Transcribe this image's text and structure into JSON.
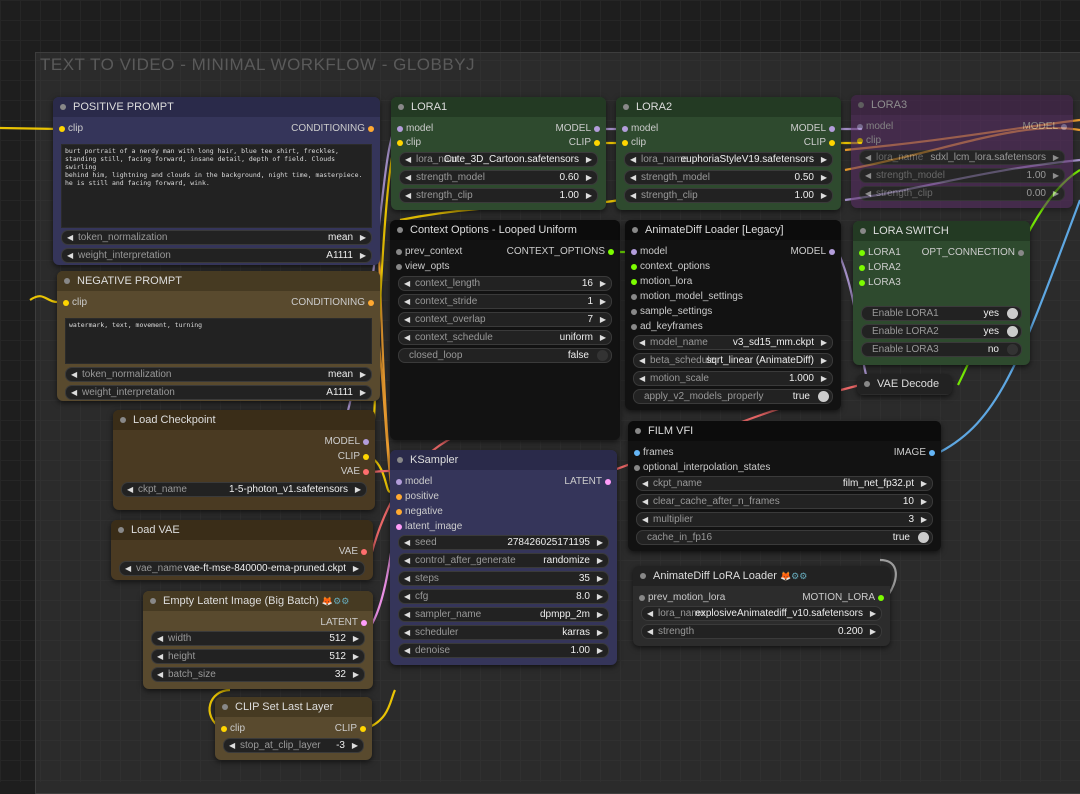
{
  "group_title": "TEXT TO VIDEO - MINIMAL WORKFLOW - GLOBBYJ",
  "positive_prompt": {
    "title": "POSITIVE PROMPT",
    "in_clip": "clip",
    "out": "CONDITIONING",
    "text": "burt portrait of a nerdy man with long hair, blue tee shirt, freckles,\nstanding still, facing forward, insane detail, depth of field. Clouds swirling\nbehind him, lightning and clouds in the background, night time, masterpiece.\nhe is still and facing forward, wink.",
    "token_normalization_label": "token_normalization",
    "token_normalization": "mean",
    "weight_interpretation_label": "weight_interpretation",
    "weight_interpretation": "A1111"
  },
  "negative_prompt": {
    "title": "NEGATIVE PROMPT",
    "in_clip": "clip",
    "out": "CONDITIONING",
    "text": "watermark, text, movement, turning",
    "token_normalization_label": "token_normalization",
    "token_normalization": "mean",
    "weight_interpretation_label": "weight_interpretation",
    "weight_interpretation": "A1111"
  },
  "load_checkpoint": {
    "title": "Load Checkpoint",
    "out_model": "MODEL",
    "out_clip": "CLIP",
    "out_vae": "VAE",
    "ckpt_name_label": "ckpt_name",
    "ckpt_name": "1-5-photon_v1.safetensors"
  },
  "load_vae": {
    "title": "Load VAE",
    "out_vae": "VAE",
    "vae_name_label": "vae_name",
    "vae_name": "vae-ft-mse-840000-ema-pruned.ckpt"
  },
  "empty_latent": {
    "title": "Empty Latent Image (Big Batch)",
    "badge": "🦊⚙⚙",
    "out_latent": "LATENT",
    "width_label": "width",
    "width": "512",
    "height_label": "height",
    "height": "512",
    "batch_size_label": "batch_size",
    "batch_size": "32"
  },
  "clip_set_last_layer": {
    "title": "CLIP Set Last Layer",
    "in_clip": "clip",
    "out_clip": "CLIP",
    "stop_label": "stop_at_clip_layer",
    "stop": "-3"
  },
  "lora1": {
    "title": "LORA1",
    "in_model": "model",
    "in_clip": "clip",
    "out_model": "MODEL",
    "out_clip": "CLIP",
    "lora_name_label": "lora_nam",
    "lora_name": "Cute_3D_Cartoon.safetensors",
    "strength_model_label": "strength_model",
    "strength_model": "0.60",
    "strength_clip_label": "strength_clip",
    "strength_clip": "1.00"
  },
  "lora2": {
    "title": "LORA2",
    "in_model": "model",
    "in_clip": "clip",
    "out_model": "MODEL",
    "out_clip": "CLIP",
    "lora_name_label": "lora_name",
    "lora_name": "euphoriaStyleV19.safetensors",
    "strength_model_label": "strength_model",
    "strength_model": "0.50",
    "strength_clip_label": "strength_clip",
    "strength_clip": "1.00"
  },
  "lora3": {
    "title": "LORA3",
    "in_model": "model",
    "in_clip": "clip",
    "out_model": "MODEL",
    "lora_name_label": "lora_name",
    "lora_name": "sdxl_lcm_lora.safetensors",
    "strength_model_label": "strength_model",
    "strength_model": "1.00",
    "strength_clip_label": "strength_clip",
    "strength_clip": "0.00"
  },
  "context_options": {
    "title": "Context Options - Looped Uniform",
    "in_prev": "prev_context",
    "in_view": "view_opts",
    "out": "CONTEXT_OPTIONS",
    "context_length_label": "context_length",
    "context_length": "16",
    "context_stride_label": "context_stride",
    "context_stride": "1",
    "context_overlap_label": "context_overlap",
    "context_overlap": "7",
    "context_schedule_label": "context_schedule",
    "context_schedule": "uniform",
    "closed_loop_label": "closed_loop",
    "closed_loop": "false"
  },
  "animatediff_loader": {
    "title": "AnimateDiff Loader [Legacy]",
    "in_model": "model",
    "in_context": "context_options",
    "in_motion_lora": "motion_lora",
    "in_motion_settings": "motion_model_settings",
    "in_sample": "sample_settings",
    "in_keyframes": "ad_keyframes",
    "out_model": "MODEL",
    "model_name_label": "model_name",
    "model_name": "v3_sd15_mm.ckpt",
    "beta_schedule_label": "beta_schedule",
    "beta_schedule": "sqrt_linear (AnimateDiff)",
    "motion_scale_label": "motion_scale",
    "motion_scale": "1.000",
    "apply_v2_label": "apply_v2_models_properly",
    "apply_v2": "true"
  },
  "lora_switch": {
    "title": "LORA SWITCH",
    "in1": "LORA1",
    "in2": "LORA2",
    "in3": "LORA3",
    "out": "OPT_CONNECTION",
    "enable1_label": "Enable LORA1",
    "enable1": "yes",
    "enable2_label": "Enable LORA2",
    "enable2": "yes",
    "enable3_label": "Enable LORA3",
    "enable3": "no"
  },
  "vae_decode": {
    "title": "VAE Decode"
  },
  "ksampler": {
    "title": "KSampler",
    "in_model": "model",
    "in_positive": "positive",
    "in_negative": "negative",
    "in_latent": "latent_image",
    "out_latent": "LATENT",
    "seed_label": "seed",
    "seed": "278426025171195",
    "control_label": "control_after_generate",
    "control": "randomize",
    "steps_label": "steps",
    "steps": "35",
    "cfg_label": "cfg",
    "cfg": "8.0",
    "sampler_label": "sampler_name",
    "sampler": "dpmpp_2m",
    "scheduler_label": "scheduler",
    "scheduler": "karras",
    "denoise_label": "denoise",
    "denoise": "1.00"
  },
  "film_vfi": {
    "title": "FILM VFI",
    "in_frames": "frames",
    "in_opt": "optional_interpolation_states",
    "out_image": "IMAGE",
    "ckpt_label": "ckpt_name",
    "ckpt": "film_net_fp32.pt",
    "clear_cache_label": "clear_cache_after_n_frames",
    "clear_cache": "10",
    "multiplier_label": "multiplier",
    "multiplier": "3",
    "cache_fp16_label": "cache_in_fp16",
    "cache_fp16": "true"
  },
  "animatediff_lora": {
    "title": "AnimateDiff LoRA Loader",
    "badge": "🦊⚙⚙",
    "in_prev": "prev_motion_lora",
    "out": "MOTION_LORA",
    "lora_name_label": "lora_name",
    "lora_name": "explosiveAnimatediff_v10.safetensors",
    "strength_label": "strength",
    "strength": "0.200"
  },
  "colors": {
    "clip": "#ffd500",
    "model": "#b39ddb",
    "conditioning": "#ffa931",
    "latent": "#ff9cf9",
    "vae": "#ff6e6e",
    "image": "#64b5f6",
    "green": "#7cfc00"
  }
}
